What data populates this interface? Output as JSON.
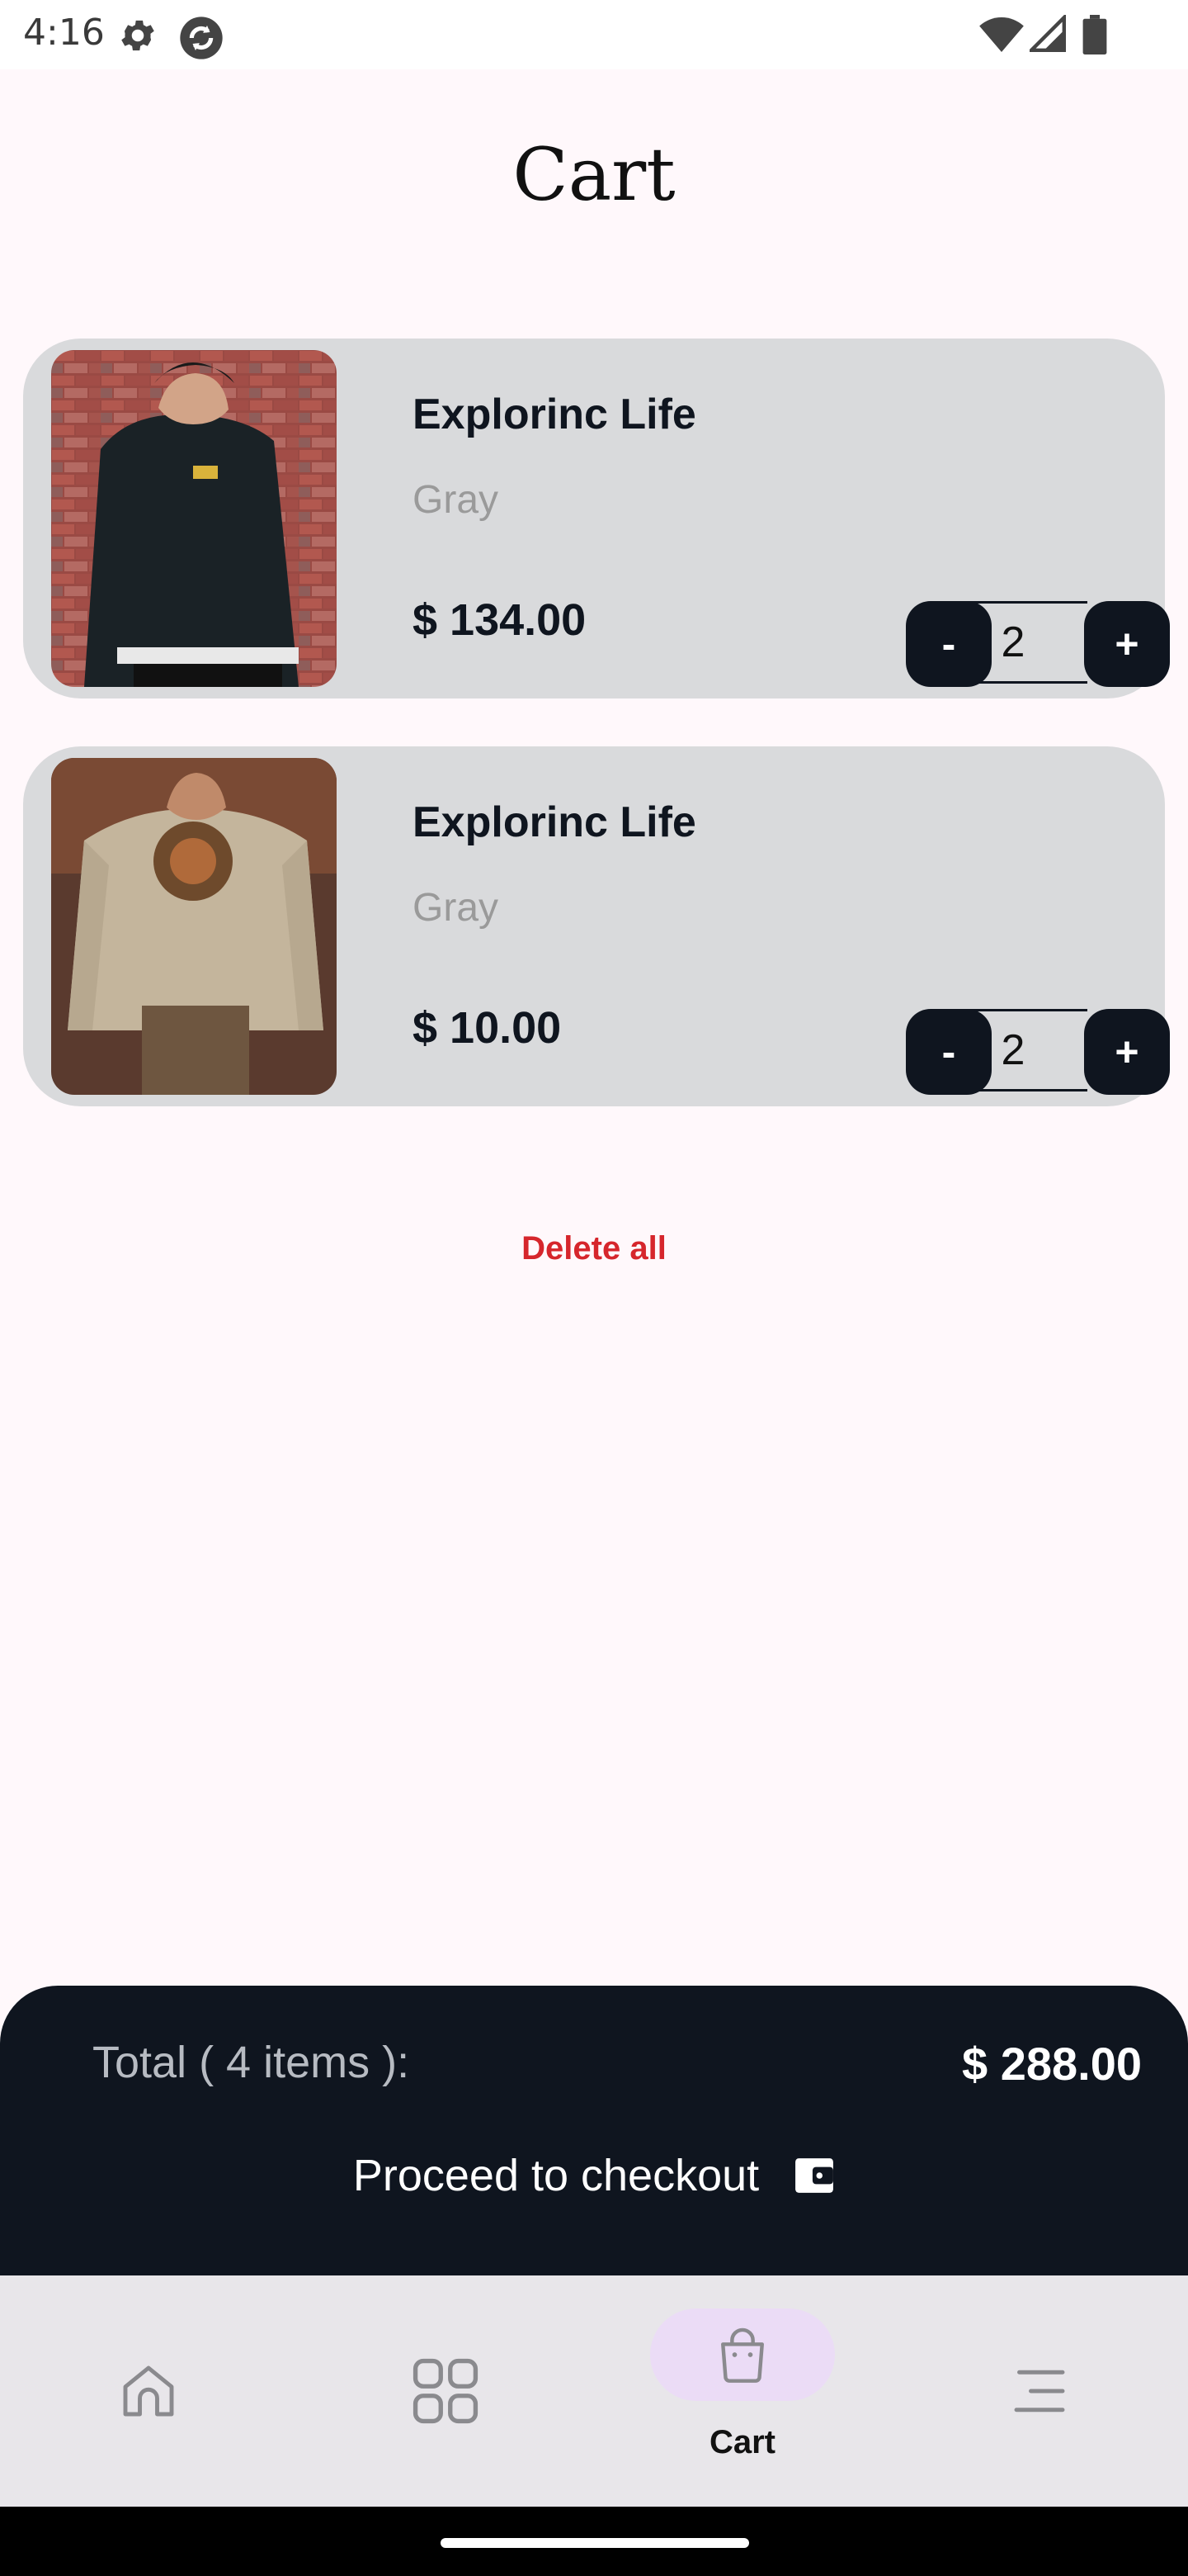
{
  "status_bar": {
    "time": "4:16"
  },
  "page": {
    "title": "Cart"
  },
  "cart_items": [
    {
      "name": "Explorinc Life",
      "color": "Gray",
      "price": "$ 134.00",
      "quantity": "2"
    },
    {
      "name": "Explorinc Life",
      "color": "Gray",
      "price": "$ 10.00",
      "quantity": "2"
    }
  ],
  "quantity_controls": {
    "minus_label": "-",
    "plus_label": "+"
  },
  "actions": {
    "delete_all": "Delete all"
  },
  "summary": {
    "total_label": "Total ( 4 items ):",
    "total_value": "$ 288.00",
    "checkout_label": "Proceed to checkout"
  },
  "nav": {
    "active": "Cart",
    "items": [
      "home-icon",
      "grid-icon",
      "bag-icon",
      "menu-icon"
    ],
    "cart_label": "Cart"
  },
  "colors": {
    "background": "#fff8fb",
    "card": "#d9dadc",
    "dark": "#0f151f",
    "danger": "#d6262c",
    "nav_active_pill": "#ebdcf6"
  }
}
